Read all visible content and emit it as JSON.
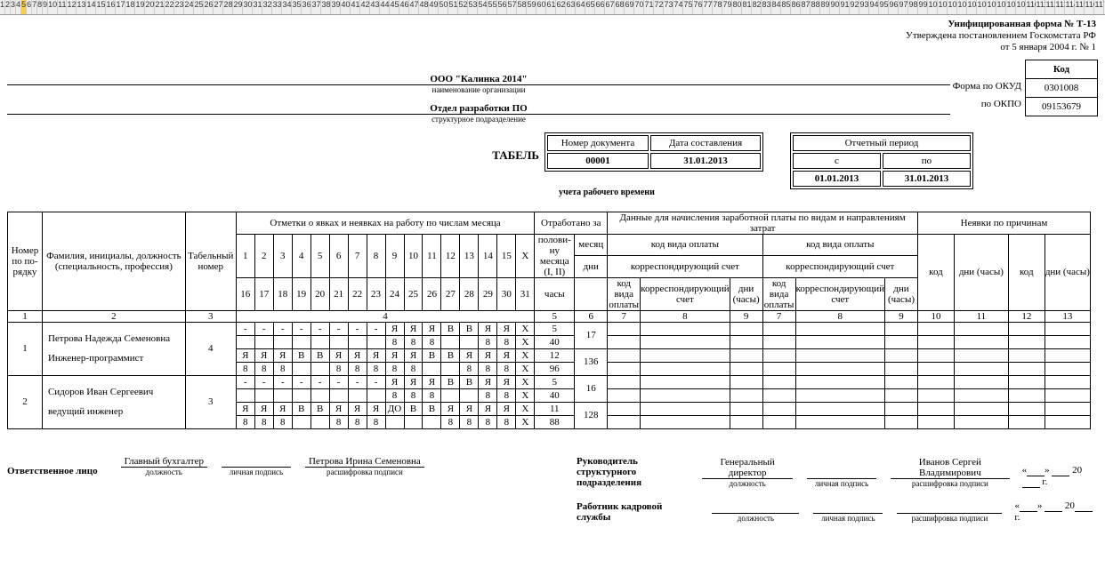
{
  "ruler_selected_index": 5,
  "form_title": "Унифицированная форма № Т-13",
  "form_approved": "Утверждена постановлением Госкомстата РФ",
  "form_date": "от 5 января 2004 г. № 1",
  "codes": {
    "header": "Код",
    "okud_label": "Форма по ОКУД",
    "okud": "0301008",
    "okpo_label": "по ОКПО",
    "okpo": "09153679"
  },
  "org_name": "ООО \"Калинка 2014\"",
  "org_sub": "наименование организации",
  "dept_name": "Отдел разработки ПО",
  "dept_sub": "структурное подразделение",
  "doc": {
    "title": "ТАБЕЛЬ",
    "sub": "учета рабочего времени",
    "num_label": "Номер документа",
    "num": "00001",
    "date_label": "Дата составления",
    "date": "31.01.2013",
    "period_label": "Отчетный период",
    "from_label": "с",
    "to_label": "по",
    "from": "01.01.2013",
    "to": "31.01.2013"
  },
  "hdr": {
    "c1": "Номер по по-рядку",
    "c2": "Фамилия, инициалы, должность (специальность, профессия)",
    "c3": "Табельный номер",
    "c4_top": "Отметки о явках и неявках на работу по числам месяца",
    "c5_top": "Отработано за",
    "c5a": "полови-ну месяца (I, II)",
    "c5b": "месяц",
    "c5c": "дни",
    "c5d": "часы",
    "c6_top": "Данные для начисления заработной платы по видам и направлениям затрат",
    "c6a": "код вида оплаты",
    "c6b": "корреспондирующий счет",
    "c6c": "код вида оплаты",
    "c6d": "корреспондирующий счет",
    "c6e": "дни (часы)",
    "c7_top": "Неявки по причинам",
    "c7a": "код",
    "c7b": "дни (часы)",
    "c7c": "код",
    "c7d": "дни (часы)"
  },
  "days_row1": [
    "1",
    "2",
    "3",
    "4",
    "5",
    "6",
    "7",
    "8",
    "9",
    "10",
    "11",
    "12",
    "13",
    "14",
    "15",
    "X"
  ],
  "days_row2": [
    "16",
    "17",
    "18",
    "19",
    "20",
    "21",
    "22",
    "23",
    "24",
    "25",
    "26",
    "27",
    "28",
    "29",
    "30",
    "31"
  ],
  "numcols": [
    "1",
    "2",
    "3",
    "4",
    "5",
    "6",
    "7",
    "8",
    "9",
    "7",
    "8",
    "9",
    "10",
    "11",
    "12",
    "13"
  ],
  "rows": [
    {
      "n": "1",
      "fio": "Петрова Надежда Семеновна",
      "pos": "Инженер-программист",
      "tab": "4",
      "half1_marks": [
        "-",
        "-",
        "-",
        "-",
        "-",
        "-",
        "-",
        "-",
        "Я",
        "Я",
        "Я",
        "В",
        "В",
        "Я",
        "Я",
        "Х"
      ],
      "half1_hrs": [
        "",
        "",
        "",
        "",
        "",
        "",
        "",
        "",
        "8",
        "8",
        "8",
        "",
        "",
        "8",
        "8",
        "Х"
      ],
      "half2_marks": [
        "Я",
        "Я",
        "Я",
        "В",
        "В",
        "Я",
        "Я",
        "Я",
        "Я",
        "Я",
        "В",
        "В",
        "Я",
        "Я",
        "Я",
        "Х"
      ],
      "half2_hrs": [
        "8",
        "8",
        "8",
        "",
        "",
        "8",
        "8",
        "8",
        "8",
        "8",
        "",
        "",
        "8",
        "8",
        "8",
        "Х"
      ],
      "d_half1": "5",
      "d_half1h": "40",
      "d_half2": "12",
      "d_half2h": "96",
      "d_month": "17",
      "d_monthh": "136"
    },
    {
      "n": "2",
      "fio": "Сидоров Иван Сергеевич",
      "pos": "ведущий инженер",
      "tab": "3",
      "half1_marks": [
        "-",
        "-",
        "-",
        "-",
        "-",
        "-",
        "-",
        "-",
        "Я",
        "Я",
        "Я",
        "В",
        "В",
        "Я",
        "Я",
        "Х"
      ],
      "half1_hrs": [
        "",
        "",
        "",
        "",
        "",
        "",
        "",
        "",
        "8",
        "8",
        "8",
        "",
        "",
        "8",
        "8",
        "Х"
      ],
      "half2_marks": [
        "Я",
        "Я",
        "Я",
        "В",
        "В",
        "Я",
        "Я",
        "Я",
        "ДО",
        "В",
        "В",
        "Я",
        "Я",
        "Я",
        "Я",
        "Х"
      ],
      "half2_hrs": [
        "8",
        "8",
        "8",
        "",
        "",
        "8",
        "8",
        "8",
        "",
        "",
        "",
        "8",
        "8",
        "8",
        "8",
        "Х"
      ],
      "d_half1": "5",
      "d_half1h": "40",
      "d_half2": "11",
      "d_half2h": "88",
      "d_month": "16",
      "d_monthh": "128"
    }
  ],
  "sig": {
    "resp": "Ответственное лицо",
    "pos1": "Главный бухгалтер",
    "pos1_cap": "должность",
    "sign_cap": "личная подпись",
    "name1": "Петрова Ирина Семеновна",
    "name_cap": "расшифровка подписи",
    "head_lbl": "Руководитель структурного подразделения",
    "head_pos": "Генеральный директор",
    "head_name": "Иванов Сергей Владимирович",
    "hr_lbl": "Работник кадровой службы",
    "date_y": "20",
    "date_g": "г."
  }
}
